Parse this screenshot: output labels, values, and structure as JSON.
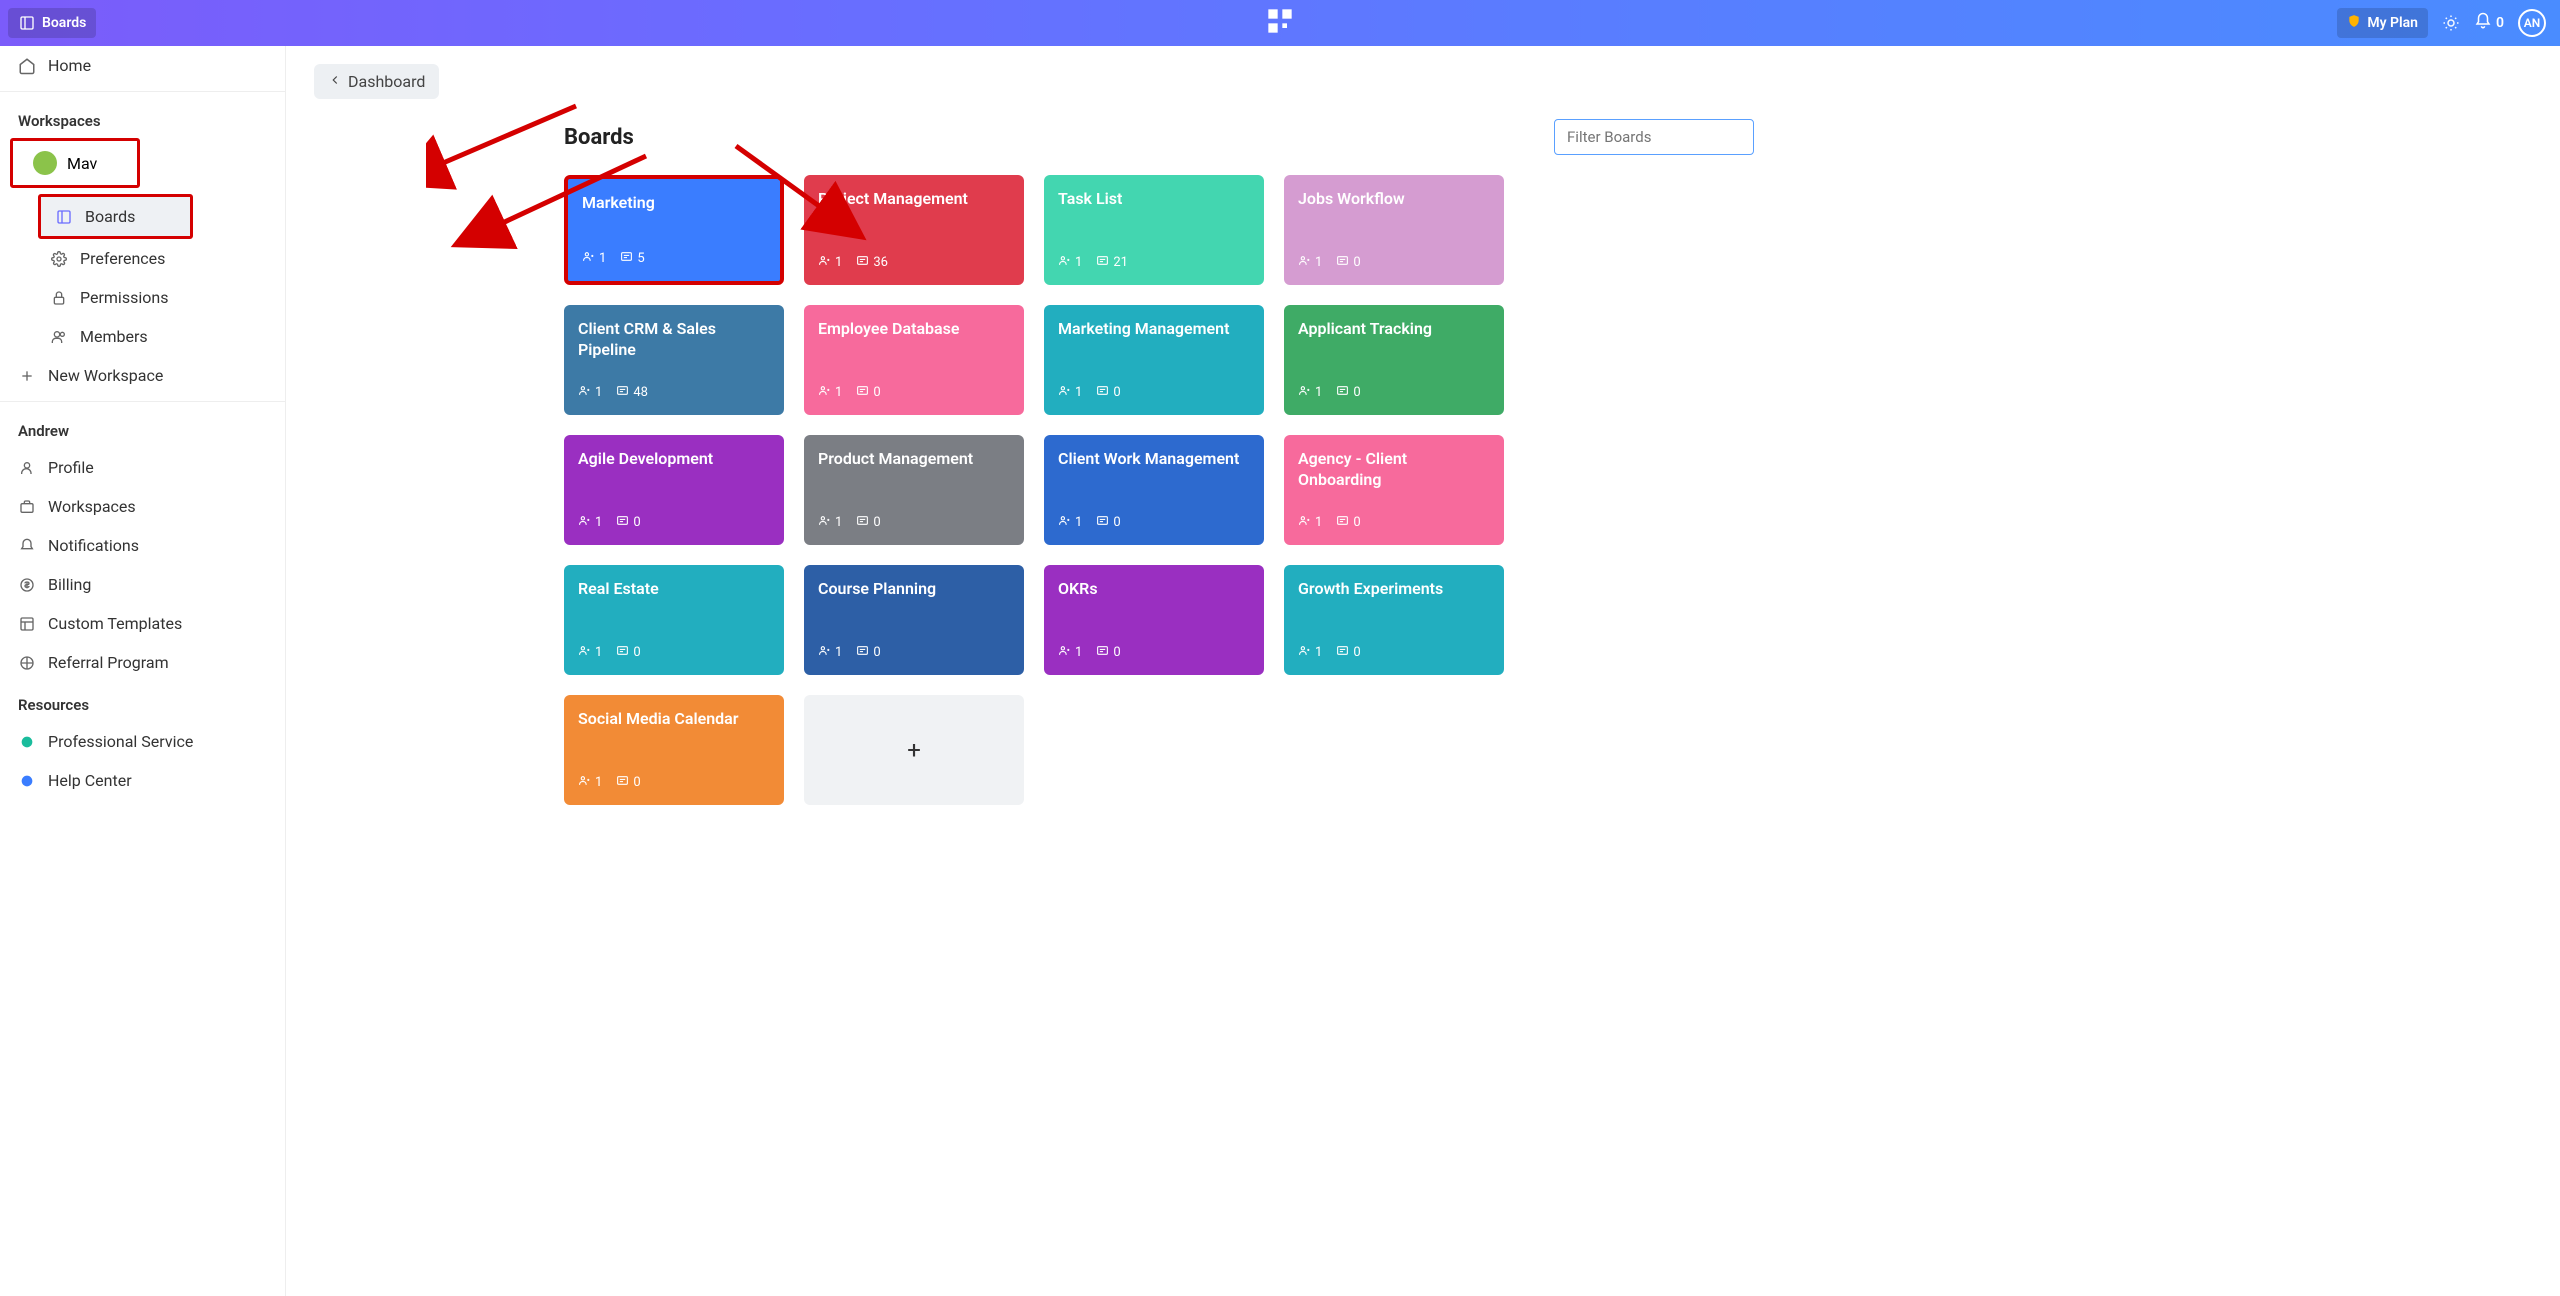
{
  "topbar": {
    "boards_label": "Boards",
    "my_plan_label": "My Plan",
    "notif_count": "0",
    "avatar": "AN"
  },
  "sidebar": {
    "home": "Home",
    "workspaces_section": "Workspaces",
    "workspace_name": "Mav",
    "ws_items": {
      "boards": "Boards",
      "preferences": "Preferences",
      "permissions": "Permissions",
      "members": "Members"
    },
    "new_workspace": "New Workspace",
    "user_section": "Andrew",
    "user_items": {
      "profile": "Profile",
      "workspaces": "Workspaces",
      "notifications": "Notifications",
      "billing": "Billing",
      "custom_templates": "Custom Templates",
      "referral": "Referral Program"
    },
    "resources_section": "Resources",
    "resources": {
      "professional": "Professional Service",
      "help": "Help Center"
    }
  },
  "content": {
    "dashboard_btn": "Dashboard",
    "page_title": "Boards",
    "filter_placeholder": "Filter Boards"
  },
  "boards": [
    {
      "title": "Marketing",
      "members": "1",
      "cards": "5",
      "color": "#3a7dff",
      "highlight": true
    },
    {
      "title": "Project Management",
      "members": "1",
      "cards": "36",
      "color": "#e03c4d"
    },
    {
      "title": "Task List",
      "members": "1",
      "cards": "21",
      "color": "#43d6b0"
    },
    {
      "title": "Jobs Workflow",
      "members": "1",
      "cards": "0",
      "color": "#d59cd1"
    },
    {
      "title": "Client CRM & Sales Pipeline",
      "members": "1",
      "cards": "48",
      "color": "#3d7aa6"
    },
    {
      "title": "Employee Database",
      "members": "1",
      "cards": "0",
      "color": "#f76a9c"
    },
    {
      "title": "Marketing Management",
      "members": "1",
      "cards": "0",
      "color": "#22aebf"
    },
    {
      "title": "Applicant Tracking",
      "members": "1",
      "cards": "0",
      "color": "#3fab66"
    },
    {
      "title": "Agile Development",
      "members": "1",
      "cards": "0",
      "color": "#9a2fc1"
    },
    {
      "title": "Product Management",
      "members": "1",
      "cards": "0",
      "color": "#7b7e84"
    },
    {
      "title": "Client Work Management",
      "members": "1",
      "cards": "0",
      "color": "#2d6acf"
    },
    {
      "title": "Agency - Client Onboarding",
      "members": "1",
      "cards": "0",
      "color": "#f76a9c"
    },
    {
      "title": "Real Estate",
      "members": "1",
      "cards": "0",
      "color": "#22aebf"
    },
    {
      "title": "Course Planning",
      "members": "1",
      "cards": "0",
      "color": "#2d5fa6"
    },
    {
      "title": "OKRs",
      "members": "1",
      "cards": "0",
      "color": "#9a2fc1"
    },
    {
      "title": "Growth Experiments",
      "members": "1",
      "cards": "0",
      "color": "#22aebf"
    },
    {
      "title": "Social Media Calendar",
      "members": "1",
      "cards": "0",
      "color": "#f28b36"
    }
  ]
}
